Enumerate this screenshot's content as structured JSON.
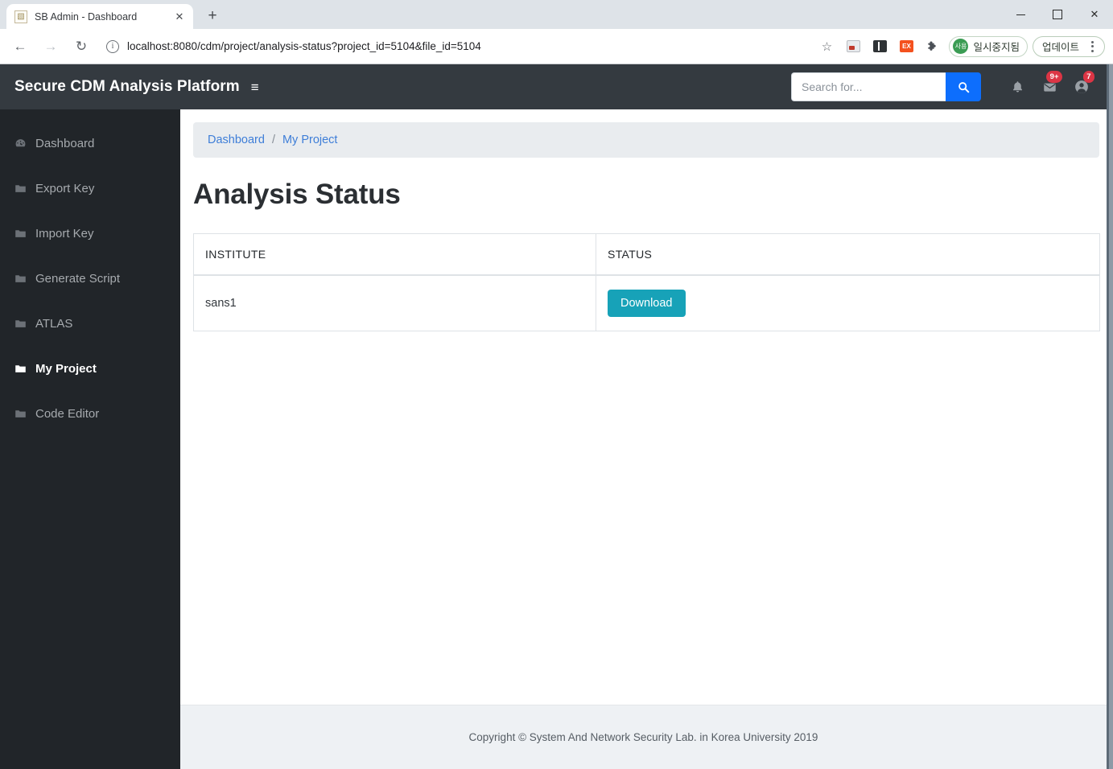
{
  "browser": {
    "tab": {
      "title": "SB Admin - Dashboard",
      "favicon": "site-favicon",
      "close_label": "✕"
    },
    "new_tab_label": "+",
    "window": {
      "minimize": "–",
      "maximize": "□",
      "close": "✕"
    },
    "nav": {
      "back": "←",
      "forward": "→",
      "reload": "↻"
    },
    "omnibox": {
      "info_icon": "i",
      "url": "localhost:8080/cdm/project/analysis-status?project_id=5104&file_id=5104",
      "bookmark_icon": "☆"
    },
    "extensions": [
      {
        "name": "photo-extension-icon",
        "label": ""
      },
      {
        "name": "reading-list-extension-icon",
        "label": ""
      },
      {
        "name": "orange-extension-icon",
        "label": "EX"
      },
      {
        "name": "puzzle-extensions-icon",
        "label": "✦"
      }
    ],
    "profile_pill": {
      "avatar_text": "사용",
      "label": "일시중지됨"
    },
    "update_pill": {
      "label": "업데이트"
    }
  },
  "topnav": {
    "brand": "Secure CDM Analysis Platform",
    "hamburger": "≡",
    "search": {
      "placeholder": "Search for...",
      "value": "",
      "button_icon": "search-icon"
    },
    "alerts": {
      "icon": "bell-icon",
      "badge": ""
    },
    "messages": {
      "icon": "envelope-icon",
      "badge": "9+"
    },
    "user": {
      "icon": "user-icon",
      "badge": "7"
    }
  },
  "sidebar": {
    "items": [
      {
        "label": "Dashboard",
        "icon": "tachometer-icon",
        "active": false
      },
      {
        "label": "Export Key",
        "icon": "folder-icon",
        "active": false
      },
      {
        "label": "Import Key",
        "icon": "folder-icon",
        "active": false
      },
      {
        "label": "Generate Script",
        "icon": "folder-icon",
        "active": false
      },
      {
        "label": "ATLAS",
        "icon": "folder-icon",
        "active": false
      },
      {
        "label": "My Project",
        "icon": "folder-icon",
        "active": true
      },
      {
        "label": "Code Editor",
        "icon": "folder-icon",
        "active": false
      }
    ]
  },
  "breadcrumb": {
    "items": [
      {
        "label": "Dashboard"
      },
      {
        "label": "My Project"
      }
    ],
    "separator": "/"
  },
  "main": {
    "title": "Analysis Status",
    "table": {
      "columns": [
        "INSTITUTE",
        "STATUS"
      ],
      "rows": [
        {
          "institute": "sans1",
          "status_button": "Download"
        }
      ]
    }
  },
  "footer": {
    "text": "Copyright © System And Network Security Lab. in Korea University 2019"
  },
  "colors": {
    "sidebar_bg": "#212529",
    "topnav_bg": "#343a40",
    "search_button": "#0d6efd",
    "download_button": "#17a2b8",
    "badge": "#dc3545",
    "link": "#3e7ed8",
    "breadcrumb_bg": "#e9ecef",
    "footer_bg": "#eef1f4"
  }
}
